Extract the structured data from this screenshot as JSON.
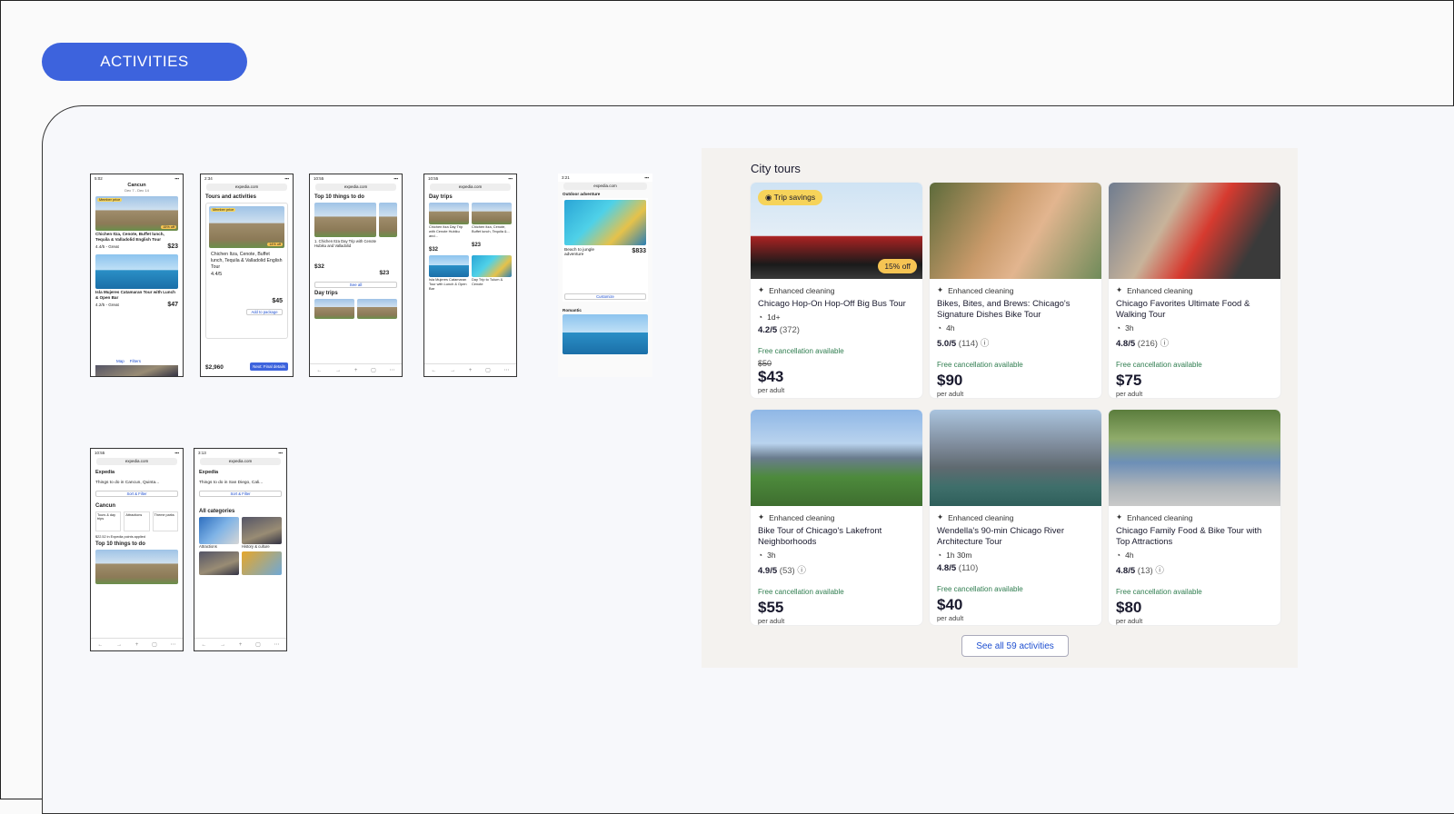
{
  "section_button": "ACTIVITIES",
  "phones": {
    "p1": {
      "time": "5:02",
      "title": "Cancun",
      "sub": "Dec 7 - Dec 14",
      "badge": "Member price",
      "off": "15% off",
      "t1": "Chichen Itza, Cenote, Buffet lunch, Tequila & Valladolid English Tour",
      "r1": "4.4/5 - Great",
      "pr1": "$23",
      "t2": "Isla Mujeres Catamaran Tour with Lunch & Open Bar",
      "r2": "4.2/5 - Great",
      "pr2": "$47",
      "map": "Map",
      "filters": "Filters"
    },
    "p2": {
      "time": "2:34",
      "url": "expedia.com",
      "h": "Tours and activities",
      "badge": "Member price",
      "off": "14% off",
      "t1": "Chichen Itza, Cenote, Buffet lunch, Tequila & Valladolid English Tour",
      "r1": "4.4/5",
      "pr": "$45",
      "add": "Add to package",
      "total": "$2,960",
      "next": "Next: Final details"
    },
    "p3": {
      "time": "10:55",
      "url": "expedia.com",
      "h": "Top 10 things to do",
      "t1": "1. Chichen Itza Day Trip with Cenote Hubiku and Valladolid",
      "pr": "$32",
      "pr2": "$23",
      "see": "See all",
      "h2": "Day trips"
    },
    "p4": {
      "time": "10:55",
      "url": "expedia.com",
      "h": "Day trips",
      "t1": "Chichen Itza Day Trip with Cenote Hubiku and...",
      "pr1": "$32",
      "t2": "Chichen Itza, Cenote, Buffet lunch, Tequila &...",
      "pr2": "$23",
      "t3": "Isla Mujeres Catamaran Tour with Lunch & Open Bar",
      "t4": "Day Trip to Tulum & Cenote"
    },
    "p5": {
      "time": "3:21",
      "url": "expedia.com",
      "h": "Outdoor adventure",
      "t1": "Beach to jungle adventure",
      "pr": "$833",
      "btn": "Customize",
      "h2": "Romantic"
    },
    "p6": {
      "time": "10:55",
      "url": "expedia.com",
      "brand": "Expedia",
      "search": "Things to do in Cancun, Quinta...",
      "sort": "Sort & Filter",
      "h": "Cancun",
      "c1": "Tours & day trips",
      "c2": "Attractions",
      "c3": "Theme parks",
      "pts": "$22.52 in Expedia points applied",
      "h2": "Top 10 things to do"
    },
    "p7": {
      "time": "3:13",
      "url": "expedia.com",
      "brand": "Expedia",
      "search": "Things to do in San Diego, Cali...",
      "sort": "Sort & Filter",
      "h": "All categories",
      "c1": "Attractions",
      "c2": "History & culture"
    }
  },
  "city_tours": {
    "title": "City tours",
    "see_all": "See all 59 activities",
    "cards": [
      {
        "badge": "Trip savings",
        "off": "15% off",
        "feature": "Enhanced cleaning",
        "name": "Chicago Hop-On Hop-Off Big Bus Tour",
        "duration": "1d+",
        "rating": "4.2/5",
        "reviews": "(372)",
        "free": "Free cancellation available",
        "old_price": "$50",
        "price": "$43",
        "per": "per adult"
      },
      {
        "feature": "Enhanced cleaning",
        "name": "Bikes, Bites, and Brews: Chicago's Signature Dishes Bike Tour",
        "duration": "4h",
        "rating": "5.0/5",
        "reviews": "(114)",
        "free": "Free cancellation available",
        "price": "$90",
        "per": "per adult"
      },
      {
        "feature": "Enhanced cleaning",
        "name": "Chicago Favorites Ultimate Food & Walking Tour",
        "duration": "3h",
        "rating": "4.8/5",
        "reviews": "(216)",
        "free": "Free cancellation available",
        "price": "$75",
        "per": "per adult"
      },
      {
        "feature": "Enhanced cleaning",
        "name": "Bike Tour of Chicago's Lakefront Neighborhoods",
        "duration": "3h",
        "rating": "4.9/5",
        "reviews": "(53)",
        "free": "Free cancellation available",
        "price": "$55",
        "per": "per adult"
      },
      {
        "feature": "Enhanced cleaning",
        "name": "Wendella's 90-min Chicago River Architecture Tour",
        "duration": "1h 30m",
        "rating": "4.8/5",
        "reviews": "(110)",
        "free": "Free cancellation available",
        "price": "$40",
        "per": "per adult"
      },
      {
        "feature": "Enhanced cleaning",
        "name": "Chicago Family Food & Bike Tour with Top Attractions",
        "duration": "4h",
        "rating": "4.8/5",
        "reviews": "(13)",
        "free": "Free cancellation available",
        "price": "$80",
        "per": "per adult"
      }
    ]
  }
}
